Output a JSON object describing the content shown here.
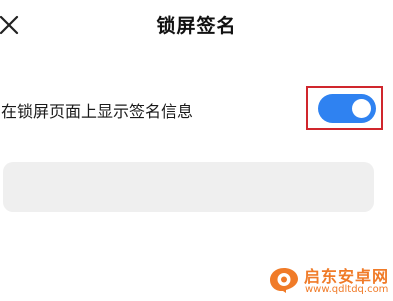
{
  "header": {
    "title": "锁屏签名",
    "close_icon": "close-icon"
  },
  "setting": {
    "label": "在锁屏页面上显示签名信息",
    "toggle_on": true,
    "toggle_color": "#2f82f1"
  },
  "signature": {
    "value": ""
  },
  "watermark": {
    "name": "启东安卓网",
    "url": "www.qdltdq.com"
  },
  "colors": {
    "accent": "#2f82f1",
    "highlight_box": "#d0262d",
    "watermark": "#f07b28"
  }
}
